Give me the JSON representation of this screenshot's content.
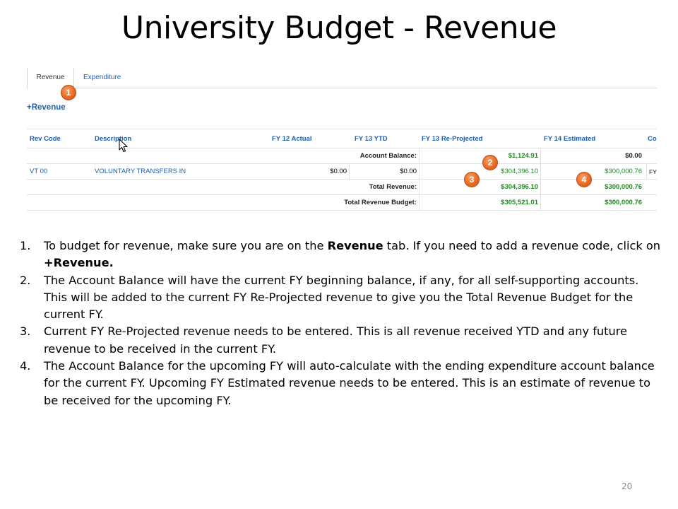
{
  "slide": {
    "title": "University Budget - Revenue",
    "page_number": "20"
  },
  "tabs": [
    {
      "label": "Revenue",
      "active": true
    },
    {
      "label": "Expenditure",
      "active": false
    }
  ],
  "add_revenue_label": "+Revenue",
  "table": {
    "headers": [
      "Rev Code",
      "Description",
      "FY 12 Actual",
      "FY 13 YTD",
      "FY 13 Re-Projected",
      "FY 14 Estimated",
      "Co"
    ],
    "account_balance": {
      "label": "Account Balance:",
      "fy13_reprojected": "$1,124.91",
      "fy14_estimated": "$0.00"
    },
    "rows": [
      {
        "rev_code": "VT 00",
        "description": "VOLUNTARY TRANSFERS IN",
        "fy12_actual": "$0.00",
        "fy13_ytd": "$0.00",
        "fy13_reprojected": "$304,396.10",
        "fy14_estimated": "$300,000.76",
        "comment": "FY"
      }
    ],
    "total_revenue": {
      "label": "Total Revenue:",
      "fy13_reprojected": "$304,396.10",
      "fy14_estimated": "$300,000.76"
    },
    "total_revenue_budget": {
      "label": "Total Revenue Budget:",
      "fy13_reprojected": "$305,521.01",
      "fy14_estimated": "$300,000.76"
    }
  },
  "markers": [
    "1",
    "2",
    "3",
    "4"
  ],
  "instructions": [
    {
      "num": "1.",
      "parts": [
        "To budget for revenue, make sure you are on the ",
        "Revenue",
        " tab.  If you need to add a revenue code, click on ",
        "+Revenue."
      ]
    },
    {
      "num": "2.",
      "text": "The Account Balance will have the current FY beginning balance, if any, for all self-supporting accounts.  This will be added to the current FY Re-Projected revenue to give you the Total Revenue Budget for the current FY."
    },
    {
      "num": "3.",
      "text": "Current FY Re-Projected revenue needs to be entered.  This is all revenue received YTD and any future revenue to be received in the current FY."
    },
    {
      "num": "4.",
      "text": "The Account Balance for the upcoming FY will auto-calculate with the ending expenditure account balance for the current FY.  Upcoming FY Estimated revenue needs to be entered.  This is an estimate of revenue to be received for the upcoming FY."
    }
  ],
  "colors": {
    "link": "#1a5fb4",
    "positive_value": "#1e8b1e",
    "marker": "#ea6a25"
  },
  "icons": {
    "cursor": "mouse-pointer-icon"
  }
}
